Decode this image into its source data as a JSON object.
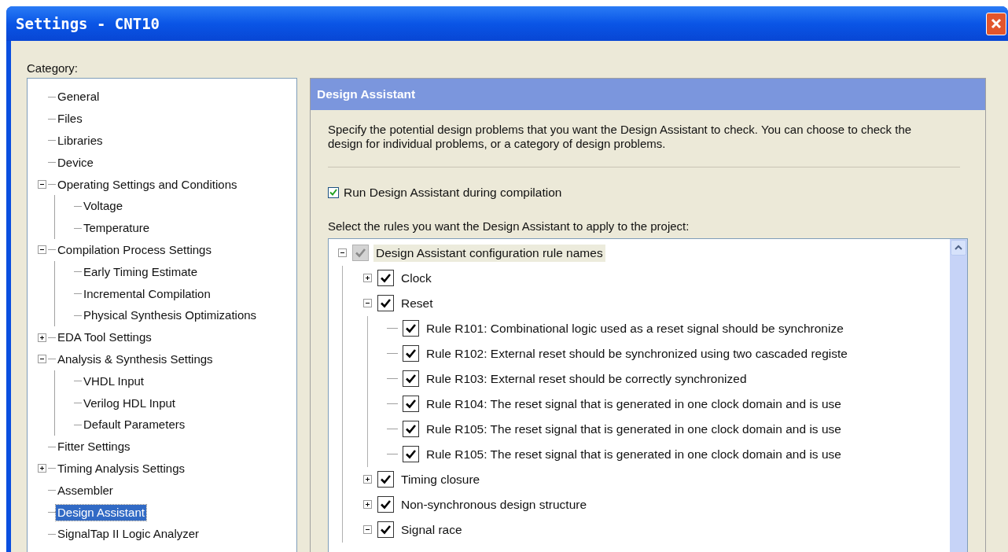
{
  "window": {
    "title": "Settings - CNT10"
  },
  "category_label": "Category:",
  "category_tree": [
    {
      "label": "General",
      "selected": false
    },
    {
      "label": "Files",
      "selected": false
    },
    {
      "label": "Libraries",
      "selected": false
    },
    {
      "label": "Device",
      "selected": false
    },
    {
      "label": "Operating Settings and Conditions",
      "selected": false,
      "expanded": true,
      "children": [
        {
          "label": "Voltage",
          "selected": false
        },
        {
          "label": "Temperature",
          "selected": false
        }
      ]
    },
    {
      "label": "Compilation Process Settings",
      "selected": false,
      "expanded": true,
      "children": [
        {
          "label": "Early Timing Estimate",
          "selected": false
        },
        {
          "label": "Incremental Compilation",
          "selected": false
        },
        {
          "label": "Physical Synthesis Optimizations",
          "selected": false
        }
      ]
    },
    {
      "label": "EDA Tool Settings",
      "selected": false,
      "expanded": false
    },
    {
      "label": "Analysis & Synthesis Settings",
      "selected": false,
      "expanded": true,
      "children": [
        {
          "label": "VHDL Input",
          "selected": false
        },
        {
          "label": "Verilog HDL Input",
          "selected": false
        },
        {
          "label": "Default Parameters",
          "selected": false
        }
      ]
    },
    {
      "label": "Fitter Settings",
      "selected": false
    },
    {
      "label": "Timing Analysis Settings",
      "selected": false,
      "expanded": false
    },
    {
      "label": "Assembler",
      "selected": false
    },
    {
      "label": "Design Assistant",
      "selected": true
    },
    {
      "label": "SignalTap II Logic Analyzer",
      "selected": false
    }
  ],
  "panel": {
    "title": "Design Assistant",
    "description": "Specify the potential design problems that you want the Design Assistant to check. You can choose to check the design for individual problems, or a category of design problems.",
    "run_option": {
      "label": "Run Design Assistant during compilation",
      "checked": true
    },
    "rules_label": "Select the rules you want the Design Assistant to apply to the project:",
    "rules_tree": [
      {
        "label": "Design Assistant configuration rule names",
        "checked": true,
        "disabled": true,
        "selected": true,
        "expanded": true,
        "children": [
          {
            "label": "Clock",
            "checked": true,
            "disabled": false,
            "selected": false,
            "expanded": false
          },
          {
            "label": "Reset",
            "checked": true,
            "disabled": false,
            "selected": false,
            "expanded": true,
            "children": [
              {
                "label": "Rule R101: Combinational logic used as a reset signal should be synchronize",
                "checked": true,
                "disabled": false,
                "selected": false
              },
              {
                "label": "Rule R102: External reset should be synchronized using two cascaded registe",
                "checked": true,
                "disabled": false,
                "selected": false
              },
              {
                "label": "Rule R103: External reset should be correctly synchronized",
                "checked": true,
                "disabled": false,
                "selected": false
              },
              {
                "label": "Rule R104: The reset signal that is generated in one clock domain and is use",
                "checked": true,
                "disabled": false,
                "selected": false
              },
              {
                "label": "Rule R105: The reset signal that is generated in one clock domain and is use",
                "checked": true,
                "disabled": false,
                "selected": false
              },
              {
                "label": "Rule R105: The reset signal that is generated in one clock domain and is use",
                "checked": true,
                "disabled": false,
                "selected": false
              }
            ]
          },
          {
            "label": "Timing closure",
            "checked": true,
            "disabled": false,
            "selected": false,
            "expanded": false
          },
          {
            "label": "Non-synchronous design structure",
            "checked": true,
            "disabled": false,
            "selected": false,
            "expanded": false
          },
          {
            "label": "Signal race",
            "checked": true,
            "disabled": false,
            "selected": false,
            "expanded": true
          }
        ]
      }
    ]
  }
}
